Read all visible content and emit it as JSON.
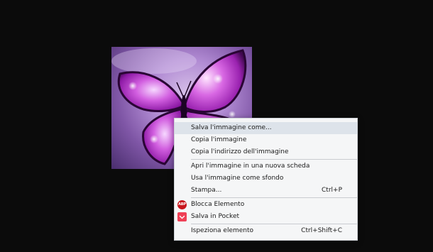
{
  "image": {
    "description_icon": "butterfly-image"
  },
  "context_menu": {
    "items": [
      {
        "label": "Salva l'immagine come...",
        "shortcut": ""
      },
      {
        "label": "Copia l'immagine",
        "shortcut": ""
      },
      {
        "label": "Copia l'indirizzo dell'immagine",
        "shortcut": ""
      },
      {
        "label": "Apri l'immagine in una nuova scheda",
        "shortcut": ""
      },
      {
        "label": "Usa l'immagine come sfondo",
        "shortcut": ""
      },
      {
        "label": "Stampa...",
        "shortcut": "Ctrl+P"
      },
      {
        "label": "Blocca Elemento",
        "shortcut": "",
        "icon": "adblock-plus-icon",
        "icon_text": "ABP"
      },
      {
        "label": "Salva in Pocket",
        "shortcut": "",
        "icon": "pocket-icon"
      },
      {
        "label": "Ispeziona elemento",
        "shortcut": "Ctrl+Shift+C"
      }
    ]
  },
  "colors": {
    "background": "#0b0b0b",
    "menu_bg": "#f5f6f7",
    "menu_highlight": "#dde3ea",
    "abp_red": "#c8161d",
    "pocket_red": "#ef4056"
  }
}
